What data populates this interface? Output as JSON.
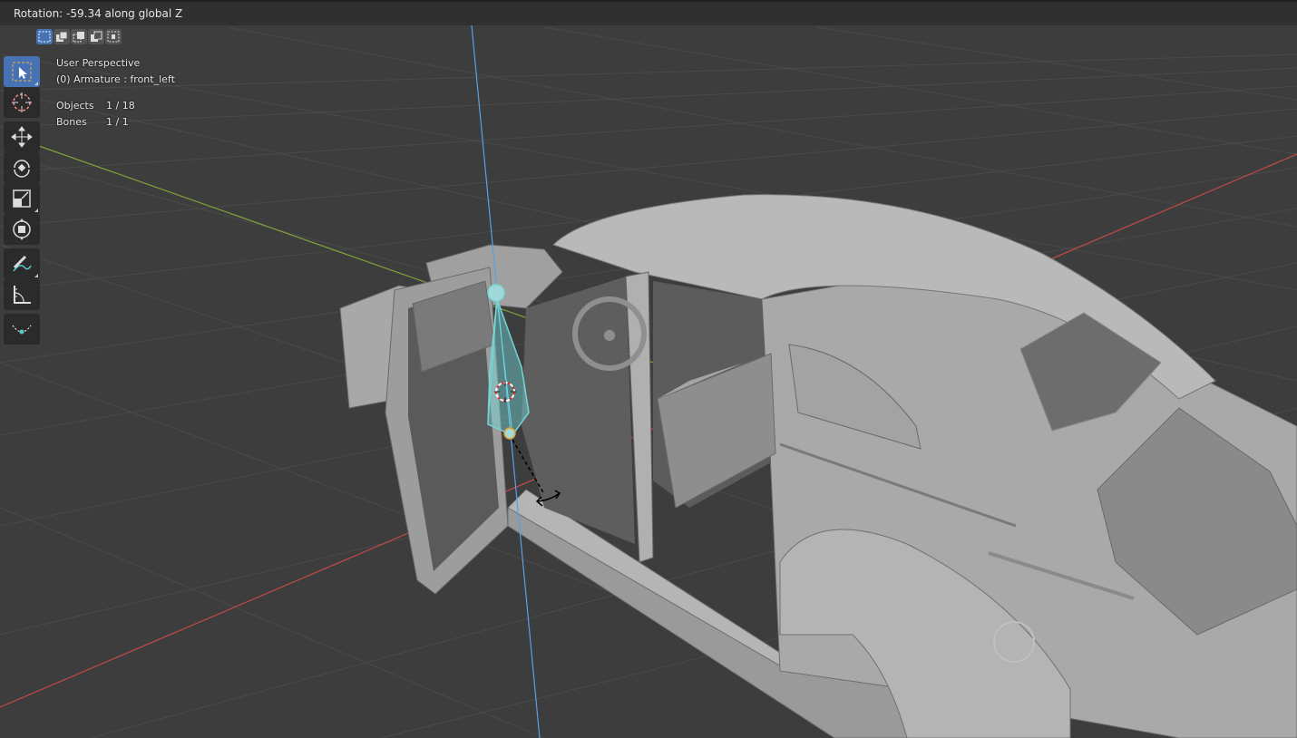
{
  "header": {
    "status_text": "Rotation: -59.34 along global Z"
  },
  "select_modes": [
    {
      "name": "set-mode",
      "active": true
    },
    {
      "name": "extend-mode",
      "active": false
    },
    {
      "name": "subtract-mode",
      "active": false
    },
    {
      "name": "invert-mode",
      "active": false
    },
    {
      "name": "intersect-mode",
      "active": false
    }
  ],
  "toolbar": {
    "tools": [
      {
        "icon": "select-box-icon",
        "active": true
      },
      {
        "icon": "cursor-icon",
        "active": false
      },
      {
        "icon": "move-icon",
        "active": false
      },
      {
        "icon": "rotate-icon",
        "active": false
      },
      {
        "icon": "scale-icon",
        "active": false
      },
      {
        "icon": "transform-icon",
        "active": false
      },
      {
        "icon": "annotate-icon",
        "active": false
      },
      {
        "icon": "measure-icon",
        "active": false
      },
      {
        "icon": "bone-roll-icon",
        "active": false
      }
    ]
  },
  "viewport_info": {
    "view_name": "User Perspective",
    "active_object": "(0) Armature : front_left",
    "stats": [
      {
        "label": "Objects",
        "value": "1 / 18"
      },
      {
        "label": "Bones",
        "value": "1 / 1"
      }
    ]
  },
  "colors": {
    "background": "#3d3d3d",
    "grid": "#4a4a4a",
    "x_axis": "#c44a4a",
    "y_axis": "#7ea33a",
    "z_axis": "#5aa0e8",
    "bone_selected": "#74d7d7",
    "active_tool": "#4772b3",
    "mesh": "#a8a8a8"
  }
}
